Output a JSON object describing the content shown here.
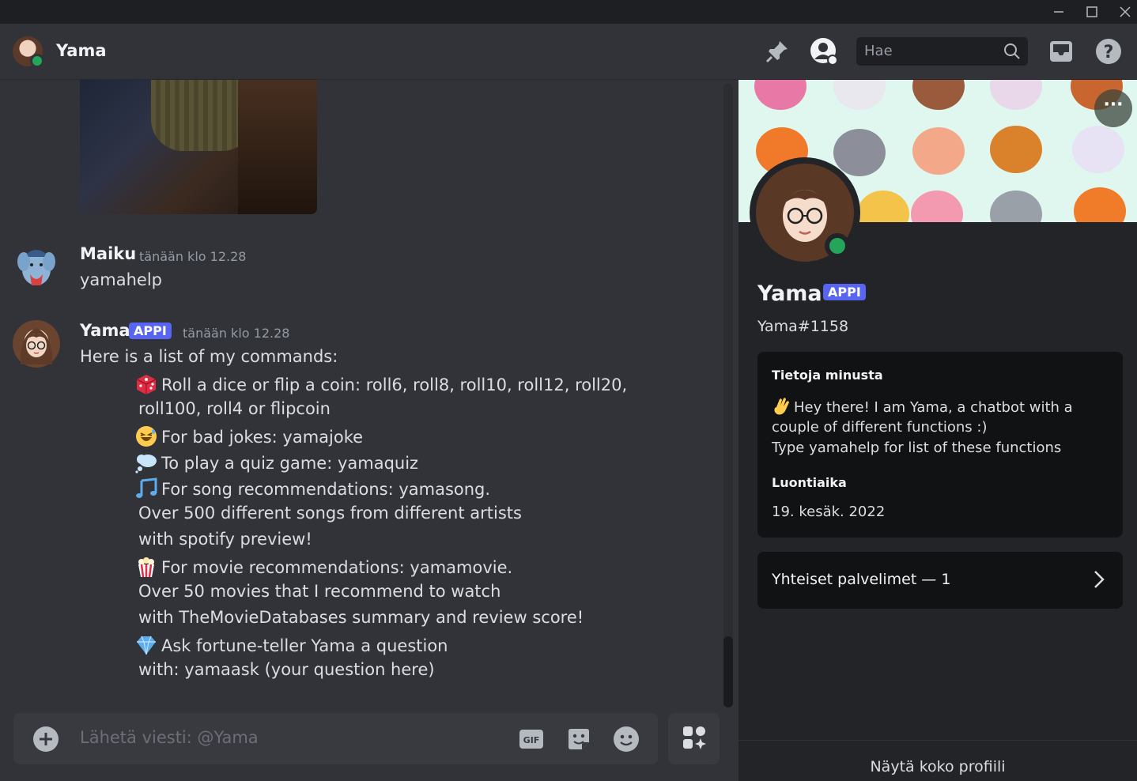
{
  "window": {
    "minimize_icon": "minimize-icon",
    "maximize_icon": "maximize-icon",
    "close_icon": "close-icon"
  },
  "header": {
    "title": "Yama",
    "search_placeholder": "Hae",
    "icons": [
      "pin-icon",
      "user-profile-icon",
      "search-icon",
      "inbox-icon",
      "help-icon"
    ]
  },
  "messages": [
    {
      "author": "Maiku",
      "timestamp": "tänään klo 12.28",
      "text": "yamahelp"
    },
    {
      "author": "Yama",
      "badge": "APPI",
      "timestamp": "tänään klo 12.28",
      "intro": "Here is a list of my commands:",
      "lines": [
        "Roll a dice or flip a coin: roll6, roll8, roll10, roll12, roll20,",
        "roll100, roll4 or flipcoin",
        "For bad jokes: yamajoke",
        "To play a quiz game: yamaquiz",
        "For song recommendations: yamasong.",
        "Over 500 different songs from different artists",
        "with spotify preview!",
        "For movie recommendations: yamamovie.",
        "Over 50 movies that I recommend to watch",
        "with TheMovieDatabases summary and review score!",
        "Ask fortune-teller Yama a question",
        "with: yamaask (your question here)"
      ]
    }
  ],
  "composer": {
    "placeholder": "Lähetä viesti: @Yama",
    "gif_label": "GIF"
  },
  "profile": {
    "name": "Yama",
    "badge": "APPI",
    "tag": "Yama#1158",
    "more_label": "···",
    "about_heading": "Tietoja minusta",
    "about_lines": [
      "Hey there! I am Yama, a chatbot with a",
      "couple of different functions :)",
      "Type yamahelp for list of these functions"
    ],
    "created_heading": "Luontiaika",
    "created_value": "19. kesäk. 2022",
    "mutual_servers": "Yhteiset palvelimet — 1",
    "footer": "Näytä koko profiili"
  },
  "colors": {
    "accent": "#5865f2",
    "online": "#23a55a",
    "background": "#313338",
    "panel": "#232428"
  }
}
